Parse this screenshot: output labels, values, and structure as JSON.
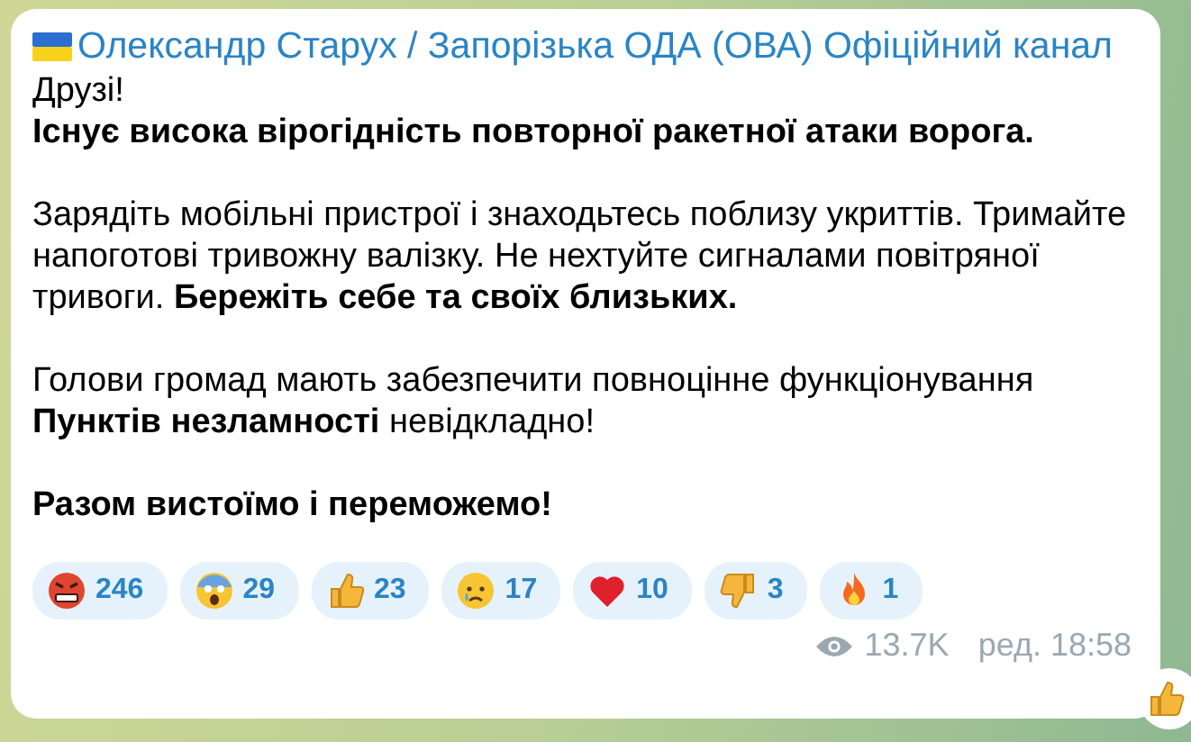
{
  "message": {
    "channel": "Олександр Старух / Запорізька ОДА (ОВА) Офіційний канал",
    "blocks": [
      [
        {
          "text": "Друзі!",
          "bold": false
        },
        {
          "text": "Існує висока вірогідність повторної ракетної атаки ворога.",
          "bold": true
        }
      ],
      [
        {
          "text": "Зарядіть мобільні пристрої і знаходьтесь поблизу укриттів. Тримайте напоготові тривожну валізку. Не нехтуйте сигналами повітряної тривоги. **Бережіть себе та своїх близьких.**",
          "bold": false
        }
      ],
      [
        {
          "text": "Голови громад мають забезпечити повноцінне функціонування **Пунктів незламності** невідкладно!",
          "bold": false
        }
      ],
      [
        {
          "text": "Разом вистоїмо і переможемо!",
          "bold": true
        }
      ]
    ],
    "reactions": [
      {
        "kind": "angry",
        "count": "246"
      },
      {
        "kind": "scream",
        "count": "29"
      },
      {
        "kind": "thumbsup",
        "count": "23"
      },
      {
        "kind": "cry",
        "count": "17"
      },
      {
        "kind": "heart",
        "count": "10"
      },
      {
        "kind": "thumbsdown",
        "count": "3"
      },
      {
        "kind": "fire",
        "count": "1"
      }
    ],
    "views": "13.7K",
    "edited_time": "ред. 18:58"
  }
}
